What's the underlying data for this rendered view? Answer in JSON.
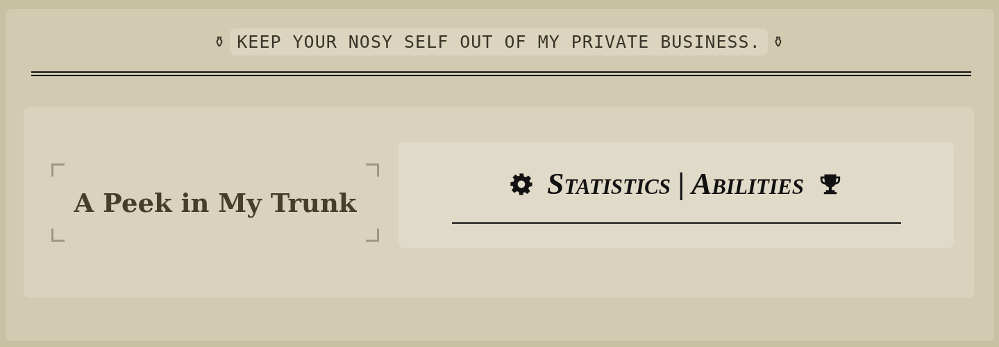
{
  "banner": {
    "left_glyph": "⚱",
    "text": "KEEP YOUR NOSY SELF OUT OF MY PRIVATE BUSINESS.",
    "right_glyph": "⚱"
  },
  "title": "A Peek in My Trunk",
  "section": {
    "heading": "Statistics | Abilities"
  }
}
